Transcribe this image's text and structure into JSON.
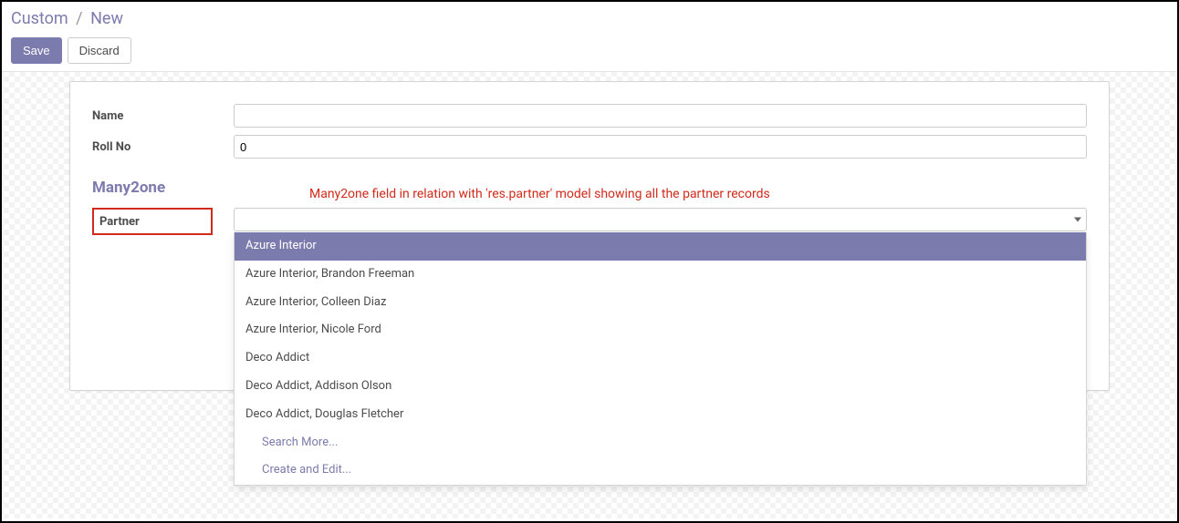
{
  "breadcrumb": {
    "parent": "Custom",
    "separator": "/",
    "current": "New"
  },
  "toolbar": {
    "save_label": "Save",
    "discard_label": "Discard"
  },
  "form": {
    "name_label": "Name",
    "name_value": "",
    "rollno_label": "Roll No",
    "rollno_value": "0",
    "section_title": "Many2one",
    "partner_label": "Partner",
    "partner_value": ""
  },
  "annotation": "Many2one field in relation with 'res.partner' model showing all the partner records",
  "dropdown": {
    "items": [
      "Azure Interior",
      "Azure Interior, Brandon Freeman",
      "Azure Interior, Colleen Diaz",
      "Azure Interior, Nicole Ford",
      "Deco Addict",
      "Deco Addict, Addison Olson",
      "Deco Addict, Douglas Fletcher"
    ],
    "search_more": "Search More...",
    "create_edit": "Create and Edit..."
  }
}
